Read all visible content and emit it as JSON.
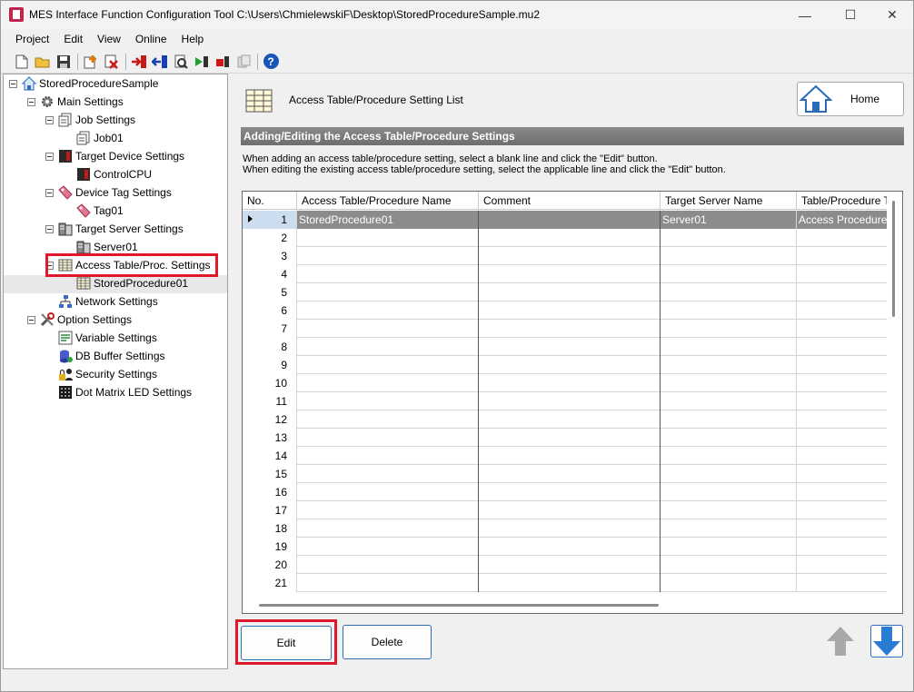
{
  "window": {
    "title": "MES Interface Function Configuration Tool C:\\Users\\ChmielewskiF\\Desktop\\StoredProcedureSample.mu2",
    "minimize_glyph": "—",
    "maximize_glyph": "☐",
    "close_glyph": "✕"
  },
  "menu": [
    "Project",
    "Edit",
    "View",
    "Online",
    "Help"
  ],
  "toolbar": {
    "icons": [
      "new-file-icon",
      "open-folder-icon",
      "save-icon",
      "add-item-icon",
      "delete-item-icon",
      "write-to-device-icon",
      "read-from-device-icon",
      "verify-icon",
      "start-icon",
      "stop-icon",
      "diagnostics-icon",
      "help-icon"
    ],
    "help_glyph": "?"
  },
  "tree": {
    "root": "StoredProcedureSample",
    "main_settings": "Main Settings",
    "job_settings": "Job Settings",
    "job01": "Job01",
    "target_device_settings": "Target Device Settings",
    "control_cpu": "ControlCPU",
    "device_tag_settings": "Device Tag Settings",
    "tag01": "Tag01",
    "target_server_settings": "Target Server Settings",
    "server01": "Server01",
    "access_table_settings": "Access Table/Proc. Settings",
    "stored_procedure01": "StoredProcedure01",
    "network_settings": "Network Settings",
    "option_settings": "Option Settings",
    "variable_settings": "Variable Settings",
    "db_buffer_settings": "DB Buffer Settings",
    "security_settings": "Security Settings",
    "dot_matrix_led_settings": "Dot Matrix LED Settings"
  },
  "main": {
    "page_title": "Access Table/Procedure Setting List",
    "home_label": "Home",
    "section_title": "Adding/Editing the Access Table/Procedure Settings",
    "instruction_1": "When adding an access table/procedure setting, select a blank line and click the \"Edit\" button.",
    "instruction_2": "When editing the existing access table/procedure setting, select the applicable line and click the \"Edit\" button.",
    "columns": [
      "No.",
      "Access Table/Procedure Name",
      "Comment",
      "Target Server Name",
      "Table/Procedure T"
    ],
    "rows": [
      {
        "no": "1",
        "name": "StoredProcedure01",
        "comment": "",
        "server": "Server01",
        "type": "Access Procedure"
      },
      {
        "no": "2",
        "name": "",
        "comment": "",
        "server": "",
        "type": ""
      },
      {
        "no": "3",
        "name": "",
        "comment": "",
        "server": "",
        "type": ""
      },
      {
        "no": "4",
        "name": "",
        "comment": "",
        "server": "",
        "type": ""
      },
      {
        "no": "5",
        "name": "",
        "comment": "",
        "server": "",
        "type": ""
      },
      {
        "no": "6",
        "name": "",
        "comment": "",
        "server": "",
        "type": ""
      },
      {
        "no": "7",
        "name": "",
        "comment": "",
        "server": "",
        "type": ""
      },
      {
        "no": "8",
        "name": "",
        "comment": "",
        "server": "",
        "type": ""
      },
      {
        "no": "9",
        "name": "",
        "comment": "",
        "server": "",
        "type": ""
      },
      {
        "no": "10",
        "name": "",
        "comment": "",
        "server": "",
        "type": ""
      },
      {
        "no": "11",
        "name": "",
        "comment": "",
        "server": "",
        "type": ""
      },
      {
        "no": "12",
        "name": "",
        "comment": "",
        "server": "",
        "type": ""
      },
      {
        "no": "13",
        "name": "",
        "comment": "",
        "server": "",
        "type": ""
      },
      {
        "no": "14",
        "name": "",
        "comment": "",
        "server": "",
        "type": ""
      },
      {
        "no": "15",
        "name": "",
        "comment": "",
        "server": "",
        "type": ""
      },
      {
        "no": "16",
        "name": "",
        "comment": "",
        "server": "",
        "type": ""
      },
      {
        "no": "17",
        "name": "",
        "comment": "",
        "server": "",
        "type": ""
      },
      {
        "no": "18",
        "name": "",
        "comment": "",
        "server": "",
        "type": ""
      },
      {
        "no": "19",
        "name": "",
        "comment": "",
        "server": "",
        "type": ""
      },
      {
        "no": "20",
        "name": "",
        "comment": "",
        "server": "",
        "type": ""
      },
      {
        "no": "21",
        "name": "",
        "comment": "",
        "server": "",
        "type": ""
      }
    ],
    "edit_label": "Edit",
    "delete_label": "Delete"
  },
  "colors": {
    "highlight": "#e0192a",
    "button_border": "#2d6fba",
    "section_bar": "#7a7a7a",
    "selected_row": "#8c8c8c",
    "down_arrow": "#2a7bd4",
    "up_arrow": "#a8a8a8"
  }
}
